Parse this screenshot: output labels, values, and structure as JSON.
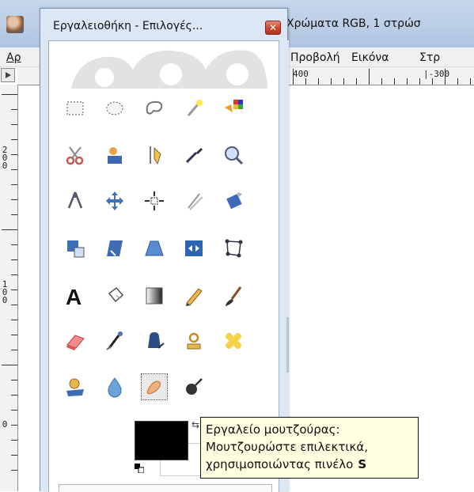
{
  "background_window": {
    "title": "Χρώματα RGB, 1 στρώσ",
    "menus": [
      {
        "label": "Αρ",
        "underline": "Α"
      },
      {
        "label": "Προβολή",
        "underline": "Π"
      },
      {
        "label": "Εικόνα",
        "underline": "ι"
      },
      {
        "label": "Στρ",
        "underline": "Σ"
      }
    ],
    "hruler_labels": [
      "400",
      "|-300"
    ],
    "vruler_labels": [
      "200",
      "100",
      "0"
    ]
  },
  "toolbox": {
    "title": "Εργαλειοθήκη - Επιλογές...",
    "close_label": "✕",
    "tools": [
      {
        "name": "rect-select-tool-icon"
      },
      {
        "name": "ellipse-select-tool-icon"
      },
      {
        "name": "free-select-tool-icon"
      },
      {
        "name": "fuzzy-select-tool-icon"
      },
      {
        "name": "select-by-color-tool-icon"
      },
      {
        "name": "scissors-select-tool-icon"
      },
      {
        "name": "foreground-select-tool-icon"
      },
      {
        "name": "paths-tool-icon"
      },
      {
        "name": "color-picker-tool-icon"
      },
      {
        "name": "zoom-tool-icon"
      },
      {
        "name": "measure-tool-icon"
      },
      {
        "name": "move-tool-icon"
      },
      {
        "name": "alignment-tool-icon"
      },
      {
        "name": "crop-tool-icon"
      },
      {
        "name": "rotate-tool-icon"
      },
      {
        "name": "scale-tool-icon"
      },
      {
        "name": "shear-tool-icon"
      },
      {
        "name": "perspective-tool-icon"
      },
      {
        "name": "flip-tool-icon"
      },
      {
        "name": "cage-transform-tool-icon"
      },
      {
        "name": "text-tool-icon"
      },
      {
        "name": "bucket-fill-tool-icon"
      },
      {
        "name": "blend-tool-icon"
      },
      {
        "name": "pencil-tool-icon"
      },
      {
        "name": "paintbrush-tool-icon"
      },
      {
        "name": "eraser-tool-icon"
      },
      {
        "name": "airbrush-tool-icon"
      },
      {
        "name": "ink-tool-icon"
      },
      {
        "name": "clone-tool-icon"
      },
      {
        "name": "heal-tool-icon"
      },
      {
        "name": "perspective-clone-tool-icon"
      },
      {
        "name": "blur-sharpen-tool-icon"
      },
      {
        "name": "smudge-tool-icon",
        "active": true
      },
      {
        "name": "dodge-burn-tool-icon"
      }
    ],
    "foreground_color": "#000000",
    "background_color": "#ffffff",
    "title_bar_color": "#dbe7f4",
    "close_button_color": "#c8452b"
  },
  "tooltip": {
    "line1": "Εργαλείο μουτζούρας:",
    "line2": "Μουτζουρώστε επιλεκτικά,",
    "line3": "χρησιμοποιώντας πινέλο",
    "shortcut": "S"
  }
}
